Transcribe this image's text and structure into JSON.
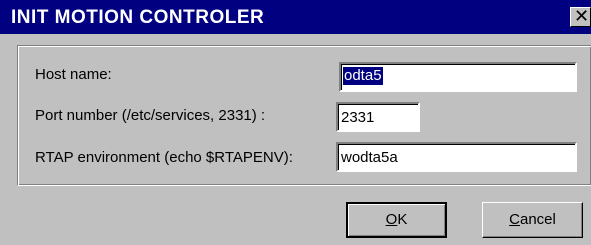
{
  "window": {
    "title": "INIT MOTION CONTROLER",
    "close_glyph": "✕"
  },
  "form": {
    "host": {
      "label": "Host name:",
      "value": "odta5"
    },
    "port": {
      "label": "Port number (/etc/services, 2331) :",
      "value": "2331"
    },
    "rtap": {
      "label": "RTAP environment (echo $RTAPENV):",
      "value": "wodta5a"
    }
  },
  "buttons": {
    "ok": {
      "mnemonic": "O",
      "rest": "K"
    },
    "cancel": {
      "mnemonic": "C",
      "rest": "ancel"
    }
  },
  "colors": {
    "titlebar": "#000080",
    "dialog": "#c0c0c0",
    "selection": "#000080"
  }
}
